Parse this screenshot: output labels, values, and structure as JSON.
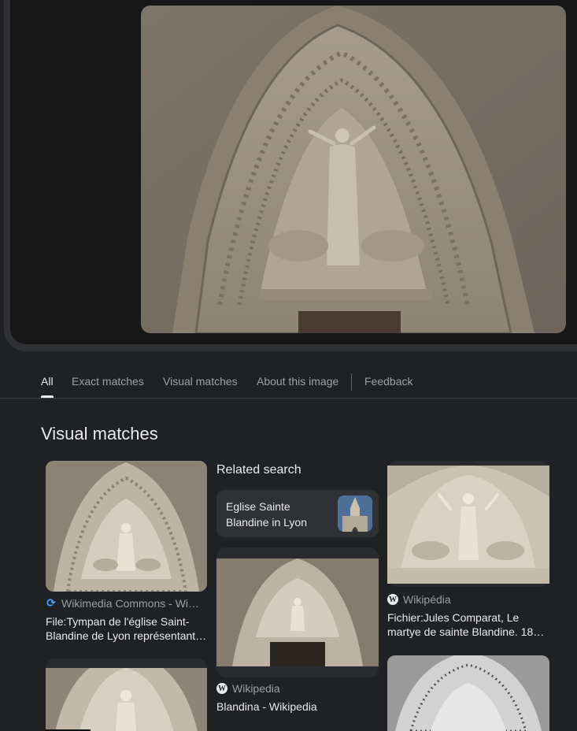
{
  "tabs": [
    {
      "label": "All",
      "active": true
    },
    {
      "label": "Exact matches",
      "active": false
    },
    {
      "label": "Visual matches",
      "active": false
    },
    {
      "label": "About this image",
      "active": false
    },
    {
      "label": "Feedback",
      "active": false
    }
  ],
  "section_title": "Visual matches",
  "results": [
    {
      "source": "Wikimedia Commons - Wi…",
      "source_icon": "wikimedia-icon",
      "caption": "File:Tympan de l'église Saint-Blandine de Lyon représentant…"
    },
    {
      "source": "Wikipedia",
      "source_icon": "wikipedia-icon",
      "caption": "Blandina - Wikipedia"
    },
    {
      "source": "Wikipédia",
      "source_icon": "wikipedia-icon",
      "caption": "Fichier:Jules Comparat, Le martye de sainte Blandine. 18…"
    }
  ],
  "related": {
    "title": "Related search",
    "chip_label": "Eglise Sainte Blandine in Lyon"
  },
  "colors": {
    "background": "#202124",
    "viewer_frame": "#303134",
    "viewer_inner": "#171717",
    "text_primary": "#e8eaed",
    "text_secondary": "#9aa0a6"
  }
}
